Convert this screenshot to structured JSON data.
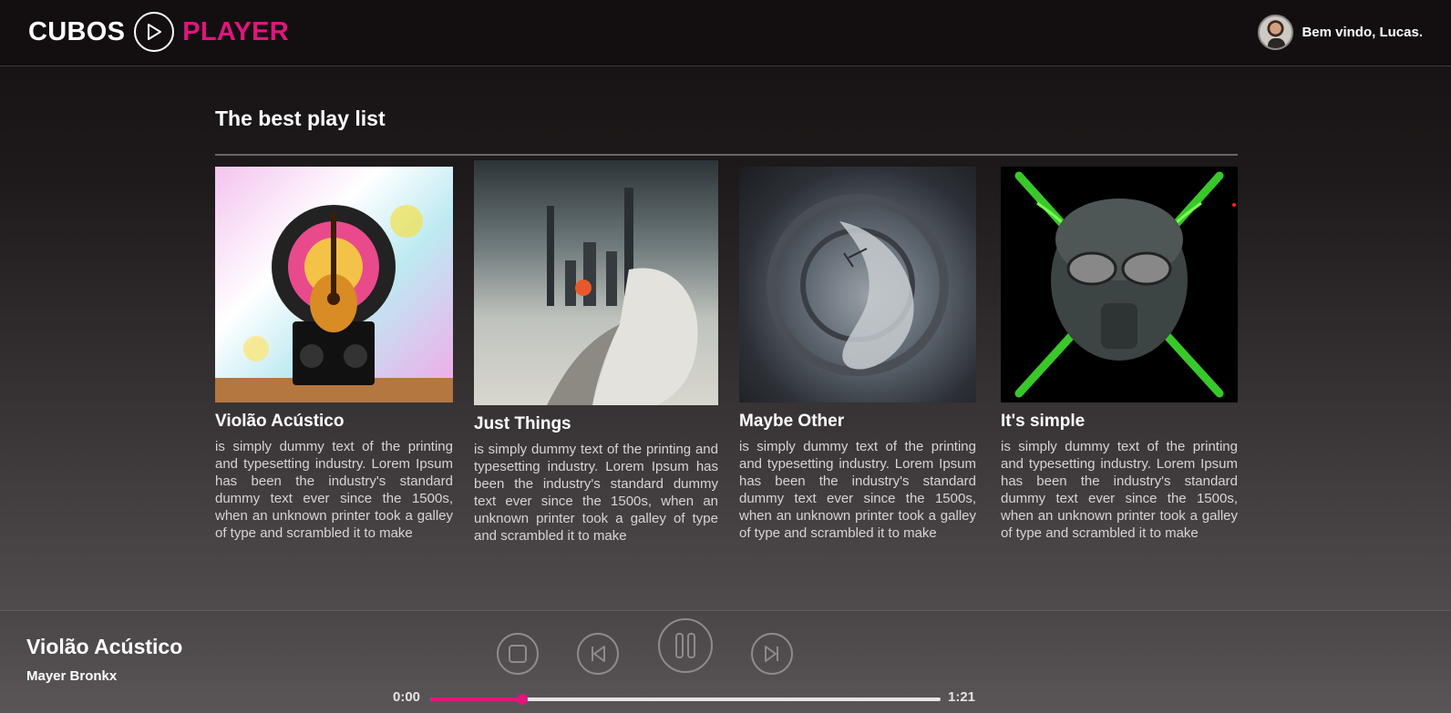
{
  "header": {
    "logo_left": "CUBOS",
    "logo_right": "PLAYER",
    "logo_icon": "play-circle-icon",
    "welcome": "Bem vindo, Lucas."
  },
  "section": {
    "title": "The best play list"
  },
  "playlist": [
    {
      "title": "Violão Acústico",
      "description": "is simply dummy text of the printing and typesetting industry. Lorem Ipsum has been the industry's standard dummy text ever since the 1500s, when an unknown printer took a galley of type and scrambled it to make"
    },
    {
      "title": "Just Things",
      "description": "is simply dummy text of the printing and typesetting industry. Lorem Ipsum has been the industry's standard dummy text ever since the 1500s, when an unknown printer took a galley of type and scrambled it to make"
    },
    {
      "title": "Maybe Other",
      "description": "is simply dummy text of the printing and typesetting industry. Lorem Ipsum has been the industry's standard dummy text ever since the 1500s, when an unknown printer took a galley of type and scrambled it to make"
    },
    {
      "title": "It's simple",
      "description": "is simply dummy text of the printing and typesetting industry. Lorem Ipsum has been the industry's standard dummy text ever since the 1500s, when an unknown printer took a galley of type and scrambled it to make"
    }
  ],
  "player": {
    "now_title": "Violão Acústico",
    "now_artist": "Mayer Bronkx",
    "time_current": "0:00",
    "time_total": "1:21",
    "progress": 0.18,
    "controls": [
      "stop-icon",
      "previous-icon",
      "pause-icon",
      "next-icon"
    ]
  },
  "colors": {
    "accent": "#e0157e",
    "header_bg": "#130f10",
    "text": "#ffffff"
  }
}
